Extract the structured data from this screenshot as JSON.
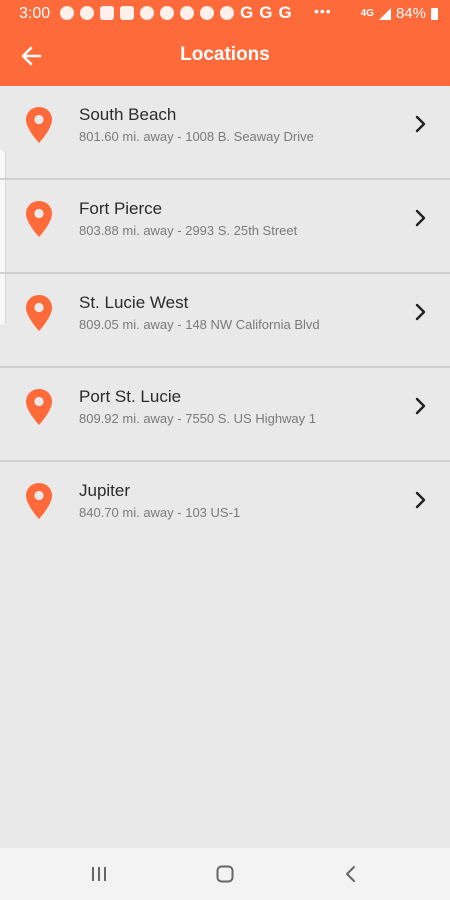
{
  "status_bar": {
    "time": "3:00",
    "battery": "84%",
    "google_letters": [
      "G",
      "G",
      "G"
    ],
    "more": "•••"
  },
  "toolbar": {
    "title": "Locations",
    "back_icon": "arrow-left-icon"
  },
  "locations": [
    {
      "name": "South Beach",
      "detail": "801.60 mi. away - 1008 B. Seaway Drive"
    },
    {
      "name": "Fort Pierce",
      "detail": "803.88 mi. away - 2993 S. 25th Street"
    },
    {
      "name": "St. Lucie West",
      "detail": "809.05 mi. away - 148 NW California Blvd"
    },
    {
      "name": "Port St. Lucie",
      "detail": "809.92 mi. away - 7550 S. US Highway 1"
    },
    {
      "name": "Jupiter",
      "detail": "840.70 mi. away - 103 US-1"
    }
  ],
  "colors": {
    "accent": "#ff6a3a",
    "background": "#e9e9e9",
    "pin": "#ff6a3a"
  },
  "icons": {
    "pin": "location-pin-icon",
    "chevron": "chevron-right-icon",
    "nav_recent": "recent-apps-icon",
    "nav_home": "home-icon",
    "nav_back": "back-icon"
  }
}
